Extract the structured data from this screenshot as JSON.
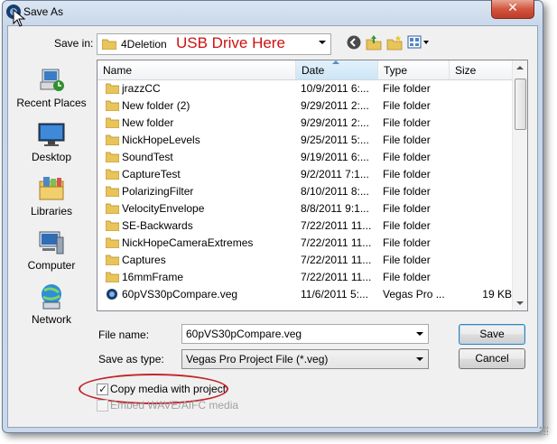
{
  "window": {
    "title": "Save As",
    "close_glyph": "✕"
  },
  "save_in": {
    "label": "Save in:",
    "value": "4Deletion",
    "annotation": "USB Drive Here"
  },
  "toolbar": {
    "icons": [
      "back-icon",
      "up-folder-icon",
      "new-folder-icon",
      "views-menu-icon"
    ]
  },
  "places": [
    {
      "label": "Recent Places",
      "icon": "recent-places-icon"
    },
    {
      "label": "Desktop",
      "icon": "desktop-icon"
    },
    {
      "label": "Libraries",
      "icon": "libraries-icon"
    },
    {
      "label": "Computer",
      "icon": "computer-icon"
    },
    {
      "label": "Network",
      "icon": "network-icon"
    }
  ],
  "columns": [
    "Name",
    "Date",
    "Type",
    "Size"
  ],
  "files": [
    {
      "name": "jrazzCC",
      "date": "10/9/2011 6:...",
      "type": "File folder",
      "size": ""
    },
    {
      "name": "New folder (2)",
      "date": "9/29/2011 2:...",
      "type": "File folder",
      "size": ""
    },
    {
      "name": "New folder",
      "date": "9/29/2011 2:...",
      "type": "File folder",
      "size": ""
    },
    {
      "name": "NickHopeLevels",
      "date": "9/25/2011 5:...",
      "type": "File folder",
      "size": ""
    },
    {
      "name": "SoundTest",
      "date": "9/19/2011 6:...",
      "type": "File folder",
      "size": ""
    },
    {
      "name": "CaptureTest",
      "date": "9/2/2011 7:1...",
      "type": "File folder",
      "size": ""
    },
    {
      "name": "PolarizingFilter",
      "date": "8/10/2011 8:...",
      "type": "File folder",
      "size": ""
    },
    {
      "name": "VelocityEnvelope",
      "date": "8/8/2011 9:1...",
      "type": "File folder",
      "size": ""
    },
    {
      "name": "SE-Backwards",
      "date": "7/22/2011 11...",
      "type": "File folder",
      "size": ""
    },
    {
      "name": "NickHopeCameraExtremes",
      "date": "7/22/2011 11...",
      "type": "File folder",
      "size": ""
    },
    {
      "name": "Captures",
      "date": "7/22/2011 11...",
      "type": "File folder",
      "size": ""
    },
    {
      "name": "16mmFrame",
      "date": "7/22/2011 11...",
      "type": "File folder",
      "size": ""
    },
    {
      "name": "60pVS30pCompare.veg",
      "date": "11/6/2011 5:...",
      "type": "Vegas Pro ...",
      "size": "19 KB"
    }
  ],
  "file_name": {
    "label": "File name:",
    "value": "60pVS30pCompare.veg"
  },
  "save_as_type": {
    "label": "Save as type:",
    "value": "Vegas Pro Project File (*.veg)"
  },
  "buttons": {
    "save": "Save",
    "cancel": "Cancel"
  },
  "options": {
    "copy_media": {
      "label": "Copy media with project",
      "checked": true
    },
    "embed_media": {
      "label": "Embed WAVE/AIFC media",
      "checked": false,
      "enabled": false
    }
  },
  "colors": {
    "annotation_red": "#cc1111",
    "highlight_oval": "#c0262c",
    "folder_yellow": "#e8c45a"
  }
}
